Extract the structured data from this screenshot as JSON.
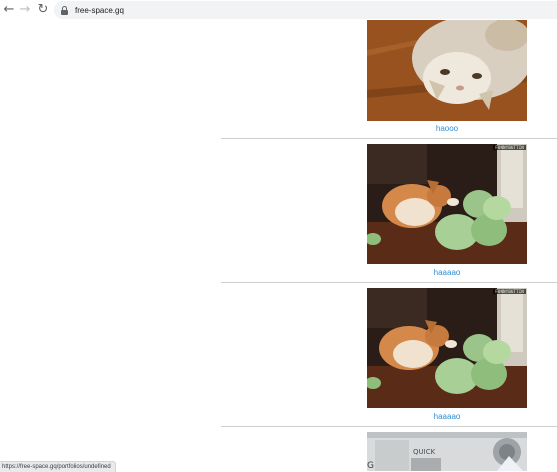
{
  "browser": {
    "url": "free-space.gq",
    "back_icon": "arrow-left",
    "forward_icon": "arrow-right",
    "reload_icon": "reload",
    "lock_icon": "lock"
  },
  "posts": [
    {
      "caption": "haooo",
      "image": "cat-lying-upside-down"
    },
    {
      "caption": "haaaao",
      "image": "corgi-eating-cabbage",
      "watermark": "FUNNYBUTTIN"
    },
    {
      "caption": "haaaao",
      "image": "corgi-eating-cabbage",
      "watermark": "FUNNYBUTTIN"
    },
    {
      "caption": "",
      "image": "machine-quick-button"
    }
  ],
  "status_bar": {
    "link": "https://free-space.gq/portfolios/undefined"
  }
}
